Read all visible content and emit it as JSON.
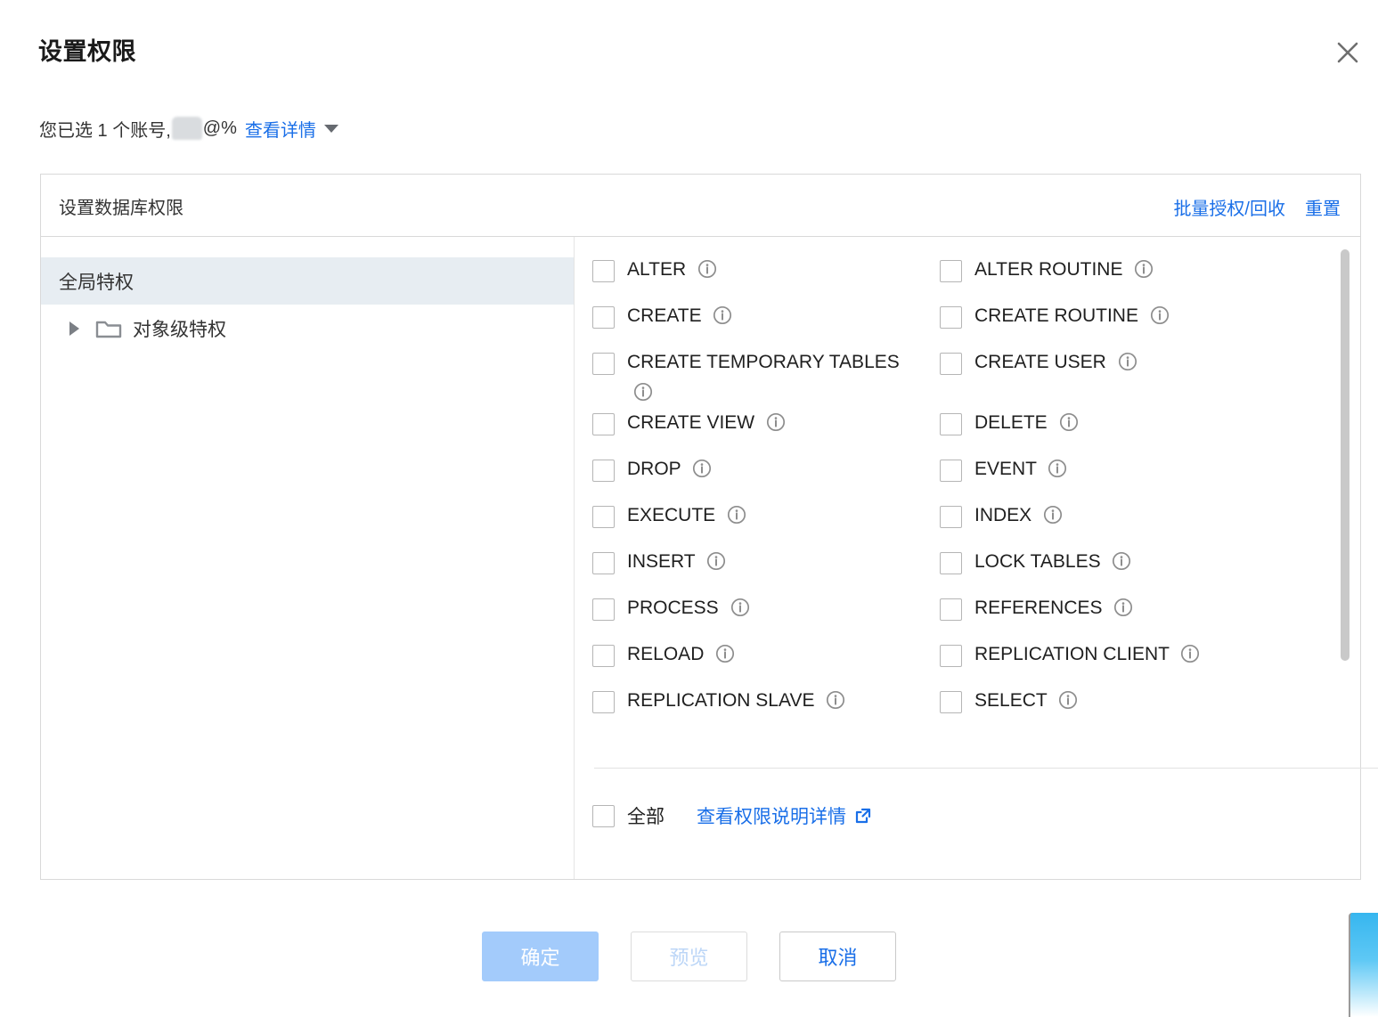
{
  "dialog": {
    "title": "设置权限",
    "close_icon": "close-icon"
  },
  "subtitle": {
    "prefix": "您已选 1 个账号, ",
    "account_suffix": "@%",
    "detail_link": "查看详情",
    "caret_icon": "chevron-down-icon"
  },
  "panel": {
    "header_title": "设置数据库权限",
    "actions": [
      {
        "label": "批量授权/回收",
        "name": "batch-grant-revoke-link"
      },
      {
        "label": "重置",
        "name": "reset-link"
      }
    ]
  },
  "tree": {
    "items": [
      {
        "label": "全局特权",
        "selected": true,
        "has_toggle": false,
        "has_folder": false
      },
      {
        "label": "对象级特权",
        "selected": false,
        "has_toggle": true,
        "has_folder": true
      }
    ]
  },
  "permissions": {
    "left_column": [
      {
        "label": "ALTER",
        "checked": false
      },
      {
        "label": "CREATE",
        "checked": false
      },
      {
        "label": "CREATE TEMPORARY TABLES",
        "checked": false
      },
      {
        "label": "CREATE VIEW",
        "checked": false
      },
      {
        "label": "DROP",
        "checked": false
      },
      {
        "label": "EXECUTE",
        "checked": false
      },
      {
        "label": "INSERT",
        "checked": false
      },
      {
        "label": "PROCESS",
        "checked": false
      },
      {
        "label": "RELOAD",
        "checked": false
      },
      {
        "label": "REPLICATION SLAVE",
        "checked": false
      }
    ],
    "right_column": [
      {
        "label": "ALTER ROUTINE",
        "checked": false
      },
      {
        "label": "CREATE ROUTINE",
        "checked": false
      },
      {
        "label": "CREATE USER",
        "checked": false
      },
      {
        "label": "DELETE",
        "checked": false
      },
      {
        "label": "EVENT",
        "checked": false
      },
      {
        "label": "INDEX",
        "checked": false
      },
      {
        "label": "LOCK TABLES",
        "checked": false
      },
      {
        "label": "REFERENCES",
        "checked": false
      },
      {
        "label": "REPLICATION CLIENT",
        "checked": false
      },
      {
        "label": "SELECT",
        "checked": false
      }
    ],
    "info_icon": "info-icon",
    "select_all": {
      "label": "全部",
      "checked": false
    },
    "doc_link": {
      "label": "查看权限说明详情",
      "icon": "external-link-icon"
    }
  },
  "footer": {
    "buttons": [
      {
        "label": "确定",
        "name": "confirm-button",
        "style": "primary-disabled"
      },
      {
        "label": "预览",
        "name": "preview-button",
        "style": "ghost-disabled"
      },
      {
        "label": "取消",
        "name": "cancel-button",
        "style": "default"
      }
    ]
  },
  "colors": {
    "link": "#1a6fe8",
    "primary_disabled": "#a3cbfb",
    "selected_row": "#e7edf2",
    "border": "#d9d9d9"
  }
}
